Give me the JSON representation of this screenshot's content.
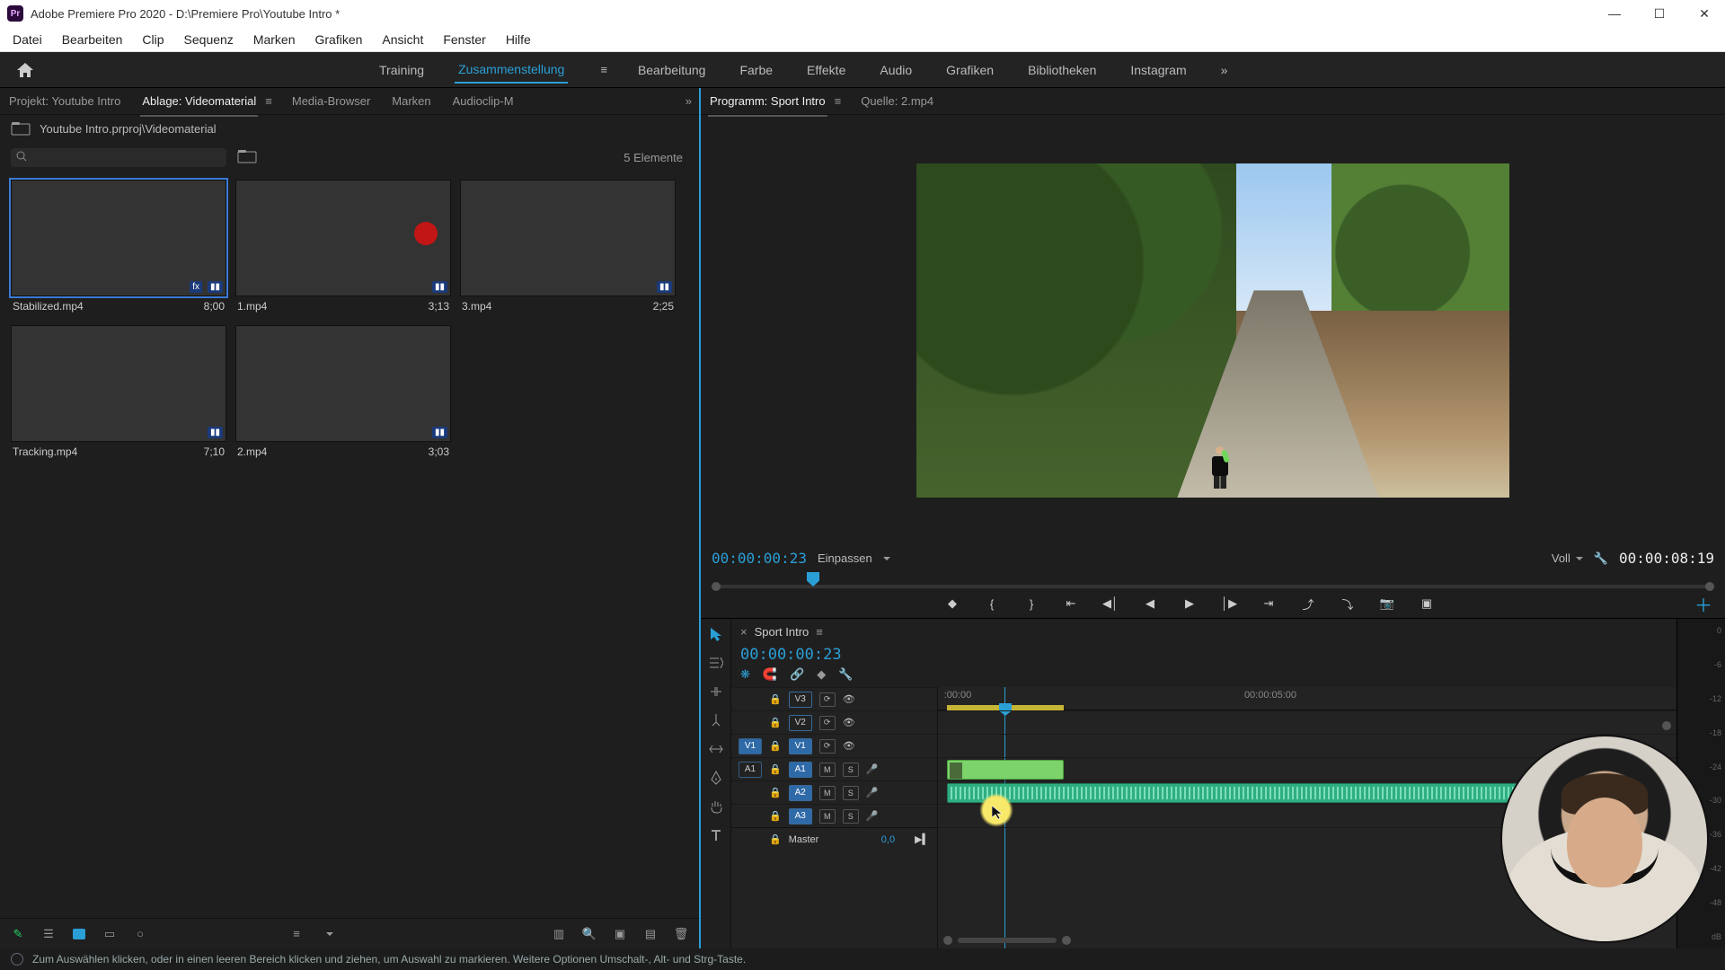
{
  "window": {
    "app_name": "Adobe Premiere Pro 2020",
    "project_path": "D:\\Premiere Pro\\Youtube Intro *",
    "title": "Adobe Premiere Pro 2020 - D:\\Premiere Pro\\Youtube Intro *"
  },
  "menu": [
    "Datei",
    "Bearbeiten",
    "Clip",
    "Sequenz",
    "Marken",
    "Grafiken",
    "Ansicht",
    "Fenster",
    "Hilfe"
  ],
  "workspaces": {
    "items": [
      "Training",
      "Zusammenstellung",
      "Bearbeitung",
      "Farbe",
      "Effekte",
      "Audio",
      "Grafiken",
      "Bibliotheken",
      "Instagram"
    ],
    "active": "Zusammenstellung"
  },
  "project_panel": {
    "tabs": [
      "Projekt: Youtube Intro",
      "Ablage: Videomaterial",
      "Media-Browser",
      "Marken",
      "Audioclip-M"
    ],
    "active_tab": "Ablage: Videomaterial",
    "breadcrumb": "Youtube Intro.prproj\\Videomaterial",
    "search_placeholder": "",
    "item_count": "5 Elemente",
    "items": [
      {
        "name": "Stabilized.mp4",
        "duration": "8;00",
        "selected": true
      },
      {
        "name": "1.mp4",
        "duration": "3;13",
        "selected": false
      },
      {
        "name": "3.mp4",
        "duration": "2;25",
        "selected": false
      },
      {
        "name": "Tracking.mp4",
        "duration": "7;10",
        "selected": false
      },
      {
        "name": "2.mp4",
        "duration": "3;03",
        "selected": false
      }
    ]
  },
  "program_monitor": {
    "tabs": [
      "Programm: Sport Intro",
      "Quelle: 2.mp4"
    ],
    "active_tab": "Programm: Sport Intro",
    "timecode_in": "00:00:00:23",
    "zoom_mode": "Einpassen",
    "resolution": "Voll",
    "timecode_out": "00:00:08:19"
  },
  "timeline": {
    "sequence_name": "Sport Intro",
    "timecode": "00:00:00:23",
    "ruler": {
      "start_label": ":00:00",
      "mid_label": "00:00:05:00"
    },
    "video_tracks": [
      {
        "source": "",
        "name": "V3",
        "locked": false,
        "visible": true
      },
      {
        "source": "",
        "name": "V2",
        "locked": false,
        "visible": true
      },
      {
        "source": "V1",
        "name": "V1",
        "locked": false,
        "visible": true,
        "source_selected": true,
        "target_selected": true
      }
    ],
    "audio_tracks": [
      {
        "source": "A1",
        "name": "A1",
        "mute": "M",
        "solo": "S",
        "rec": true,
        "target_selected": true
      },
      {
        "source": "",
        "name": "A2",
        "mute": "M",
        "solo": "S",
        "rec": true,
        "target_selected": true
      },
      {
        "source": "",
        "name": "A3",
        "mute": "M",
        "solo": "S",
        "rec": true,
        "target_selected": true
      }
    ],
    "master": {
      "label": "Master",
      "value": "0,0"
    }
  },
  "audio_meter_scale": [
    "0",
    "-6",
    "-12",
    "-18",
    "-24",
    "-30",
    "-36",
    "-42",
    "-48",
    "-∞",
    "dB"
  ],
  "status_text": "Zum Auswählen klicken, oder in einen leeren Bereich klicken und ziehen, um Auswahl zu markieren. Weitere Optionen Umschalt-, Alt- und Strg-Taste."
}
